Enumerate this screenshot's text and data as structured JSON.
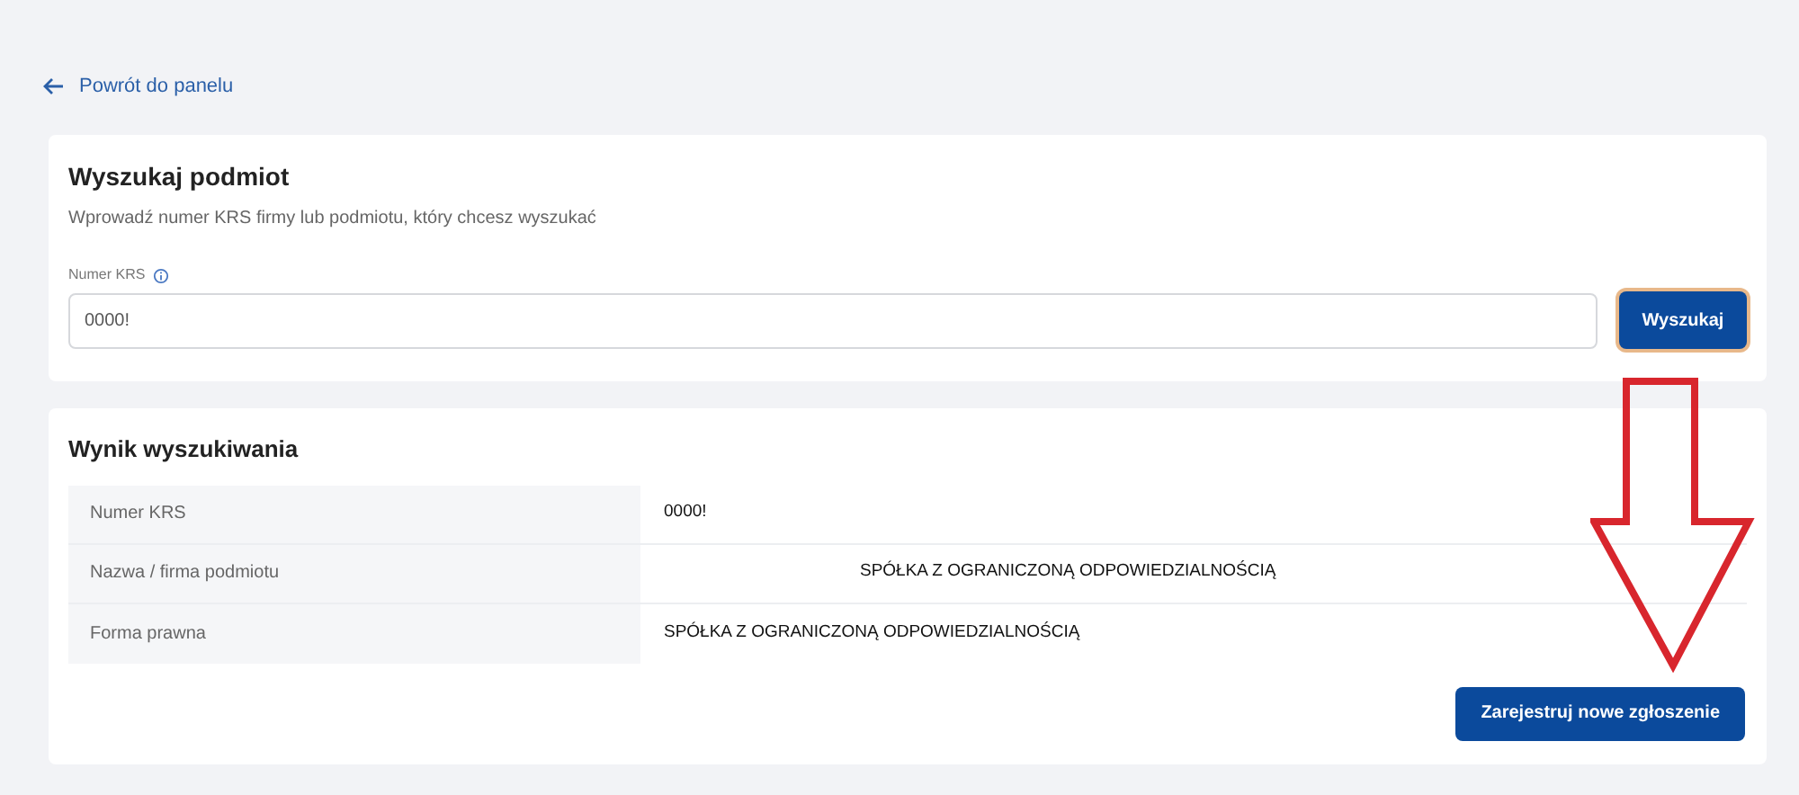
{
  "back_link": "Powrót do panelu",
  "search_card": {
    "title": "Wyszukaj podmiot",
    "description": "Wprowadź numer KRS firmy lub podmiotu, który chcesz wyszukać",
    "field_label": "Numer KRS",
    "field_value": "0000!",
    "button": {
      "label": "Wyszukaj",
      "focused": true
    }
  },
  "result_card": {
    "title": "Wynik wyszukiwania",
    "rows": [
      {
        "label": "Numer KRS",
        "value": "0000!",
        "kind": "plain"
      },
      {
        "label": "Nazwa / firma podmiotu",
        "value": "SPÓŁKA Z OGRANICZONĄ ODPOWIEDZIALNOŚCIĄ",
        "kind": "indented"
      },
      {
        "label": "Forma prawna",
        "value": "SPÓŁKA Z OGRANICZONĄ ODPOWIEDZIALNOŚCIĄ",
        "kind": "plain"
      }
    ],
    "button": "Zarejestruj nowe zgłoszenie"
  }
}
